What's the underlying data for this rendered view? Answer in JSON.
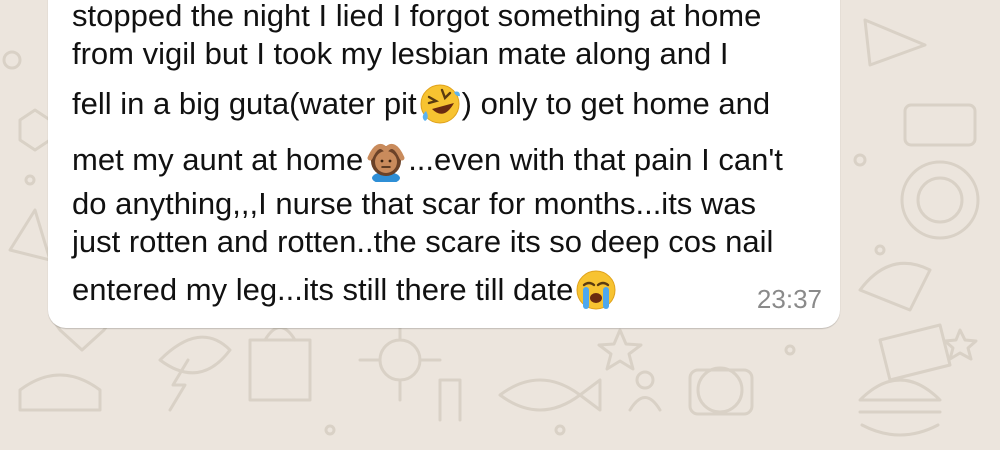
{
  "chat": {
    "background_color": "#ece5dd",
    "bubble_color": "#ffffff",
    "message": {
      "line1": "stopped the night I lied I forgot something at home",
      "line2": "from vigil but I took my lesbian mate along and I",
      "line3a": "fell in a big guta(water pit",
      "line3b": ") only to get home and",
      "line4a": "met my aunt at home",
      "line4b": "...even with that pain I can't",
      "line5": "do anything,,,I nurse that scar for months...its was",
      "line6": "just rotten and rotten..the scare its so deep cos nail",
      "line7a": "entered my leg...its still there till date",
      "emojis": [
        "rolling-on-floor-laughing-emoji",
        "person-gesturing-no-emoji",
        "loudly-crying-emoji"
      ]
    },
    "timestamp": "23:37"
  }
}
